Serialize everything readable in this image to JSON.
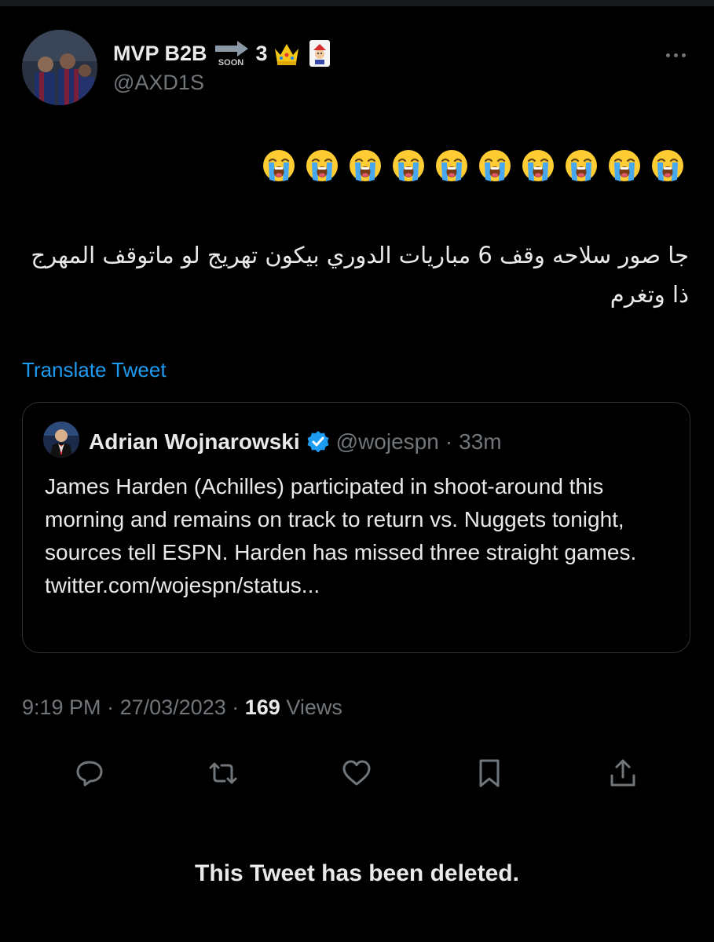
{
  "author": {
    "display_name": "MVP B2B",
    "soon_label": "SOON",
    "name_suffix": "3",
    "handle": "@AXD1S"
  },
  "tweet": {
    "emojis": [
      "😭",
      "😭",
      "😭",
      "😭",
      "😭",
      "😭",
      "😭",
      "😭",
      "😭",
      "😭"
    ],
    "text": "جا صور سلاحه وقف 6 مباريات الدوري بيكون تهريج لو ماتوقف المهرج ذا وتغرم",
    "translate_label": "Translate Tweet"
  },
  "quoted_tweet": {
    "name": "Adrian Wojnarowski",
    "handle": "@wojespn",
    "separator": "·",
    "time": "33m",
    "text": "James Harden (Achilles) participated in shoot-around this morning and remains on track to return vs. Nuggets tonight, sources tell ESPN. Harden has missed three straight games. twitter.com/wojespn/status..."
  },
  "meta": {
    "time": "9:19 PM",
    "sep1": "·",
    "date": "27/03/2023",
    "sep2": "·",
    "views_count": "169",
    "views_label": "Views"
  },
  "actions": {
    "icons": [
      "reply-icon",
      "retweet-icon",
      "like-icon",
      "bookmark-icon",
      "share-icon"
    ]
  },
  "deleted_notice": "This Tweet has been deleted.",
  "colors": {
    "background": "#000000",
    "text": "#e7e9ea",
    "secondary": "#71767b",
    "link": "#1d9bf0",
    "border": "#2f3336"
  }
}
